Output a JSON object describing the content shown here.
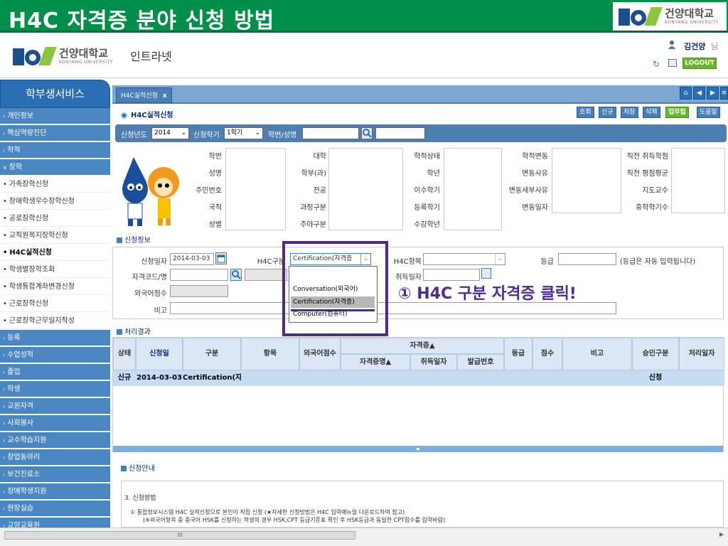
{
  "slide": {
    "title": "H4C 자격증 분야 신청 방법"
  },
  "brand": {
    "name_ko": "건양대학교",
    "name_en": "KONYANG UNIVERSITY"
  },
  "header": {
    "intranet": "인트라넷",
    "user_name": "김건양",
    "user_suffix": "님",
    "logout": "LOGOUT"
  },
  "sidebar": {
    "title": "학부생서비스",
    "items": [
      {
        "label": "개인정보",
        "type": "cat"
      },
      {
        "label": "핵심역량진단",
        "type": "cat"
      },
      {
        "label": "학적",
        "type": "cat"
      },
      {
        "label": "장학",
        "type": "cat-open"
      },
      {
        "label": "가족장학신청",
        "type": "sub"
      },
      {
        "label": "장애학생우수장학신청",
        "type": "sub"
      },
      {
        "label": "공로장학신청",
        "type": "sub"
      },
      {
        "label": "교직원복지장학신청",
        "type": "sub"
      },
      {
        "label": "H4C실적신청",
        "type": "sub-active"
      },
      {
        "label": "학생별장학조회",
        "type": "sub"
      },
      {
        "label": "학생통합계좌변경신청",
        "type": "sub"
      },
      {
        "label": "근로장학신청",
        "type": "sub"
      },
      {
        "label": "근로장학근무일지작성",
        "type": "sub"
      },
      {
        "label": "등록",
        "type": "cat"
      },
      {
        "label": "수업성적",
        "type": "cat"
      },
      {
        "label": "졸업",
        "type": "cat"
      },
      {
        "label": "학생",
        "type": "cat"
      },
      {
        "label": "교원자격",
        "type": "cat"
      },
      {
        "label": "사회봉사",
        "type": "cat"
      },
      {
        "label": "교수학습지원",
        "type": "cat"
      },
      {
        "label": "창업동아리",
        "type": "cat"
      },
      {
        "label": "보건진료소",
        "type": "cat"
      },
      {
        "label": "장애학생지원",
        "type": "cat"
      },
      {
        "label": "현장실습",
        "type": "cat"
      },
      {
        "label": "교양교육원",
        "type": "cat"
      }
    ]
  },
  "tabs": {
    "active": "H4C실적신청",
    "close": "x"
  },
  "page": {
    "title": "H4C실적신청"
  },
  "toolbar": [
    "조회",
    "신규",
    "저장",
    "삭제",
    "업무팁",
    "도움말"
  ],
  "search": {
    "year_label": "신청년도",
    "year": "2014",
    "term_label": "신청학기",
    "term": "1학기",
    "id_label": "학번/성명"
  },
  "student_info": {
    "col1": [
      "학번",
      "성명",
      "주민번호",
      "국적",
      "성별"
    ],
    "col2": [
      "대학",
      "학부(과)",
      "전공",
      "과정구분",
      "주야구분"
    ],
    "col3": [
      "학적상태",
      "학년",
      "이수학기",
      "등록학기",
      "수강학년"
    ],
    "col4": [
      "학적변동",
      "변동사유",
      "변동세부사유",
      "변동일자"
    ],
    "col5": [
      "직전 취득학점",
      "직전 평점평균",
      "지도교수",
      "휴학학기수"
    ]
  },
  "apply_section": {
    "title": "신청정보",
    "date_label": "신청일자",
    "date": "2014-03-03",
    "type_label": "H4C구분",
    "type_value": "Certification(자격증",
    "item_label": "H4C항목",
    "grade_label": "등급",
    "grade_note": "(등급은 자동 입력됩니다)",
    "code_label": "자격코드/명",
    "acq_label": "취득일자",
    "lang_label": "외국어점수",
    "note_label": "비고"
  },
  "dropdown": {
    "options": [
      "Conversation(외국어)",
      "Certification(자격증)",
      "Computer(컴퓨터)"
    ],
    "selected": "Certification(자격증)"
  },
  "annotation": "① H4C 구분 자격증 클릭!",
  "result_section": {
    "title": "처리결과",
    "headers": {
      "status": "상태",
      "date": "신청일",
      "type": "구분",
      "item": "항목",
      "lang": "외국어점수",
      "cert": "자격증▲",
      "cert_name": "자격증명▲",
      "acq_date": "취득일자",
      "issue_no": "발급번호",
      "grade": "등급",
      "score": "점수",
      "note": "비고",
      "approval": "승인구분",
      "proc_date": "처리일자"
    },
    "row": {
      "status": "신규",
      "date": "2014-03-03",
      "type": "Certification(자",
      "approval": "신청"
    }
  },
  "help_section": {
    "title": "신청안내",
    "heading": "3. 신청방법",
    "line1": "① 통합정보시스템 H4C 실적신청으로 본인이 직접 신청 (★자세한 신청방법은 H4C 입력매뉴얼 다운로드하여 참고)",
    "line2": "(※외국어항목 중 중국어 HSK를 신청하는 학생의 경우 HSK,CPT 등급기준표 확인 후 HSK등급과 동일한 CPT점수를 입력바람)"
  },
  "scrollbar": {
    "grip": "III"
  }
}
